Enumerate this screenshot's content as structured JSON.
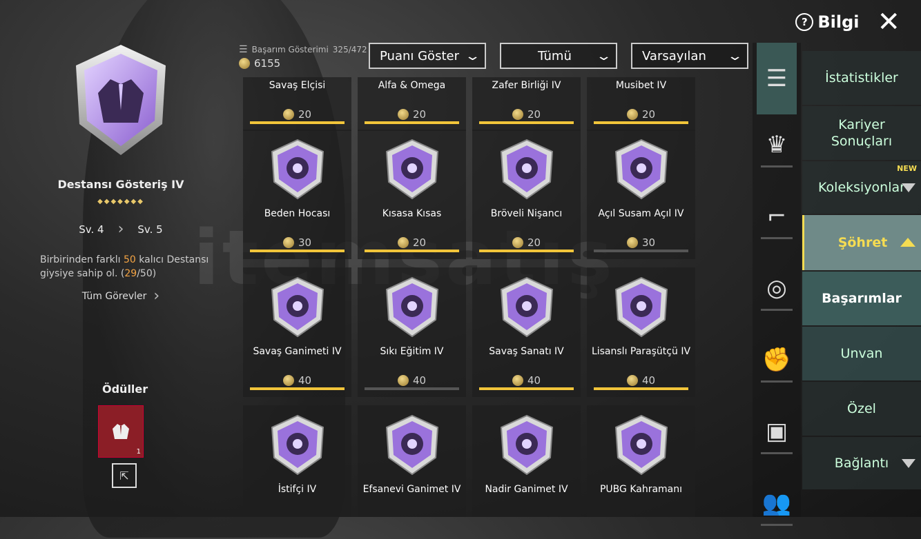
{
  "header": {
    "help_label": "Bilgi",
    "close_symbol": "✕"
  },
  "selected": {
    "name": "Destansı Gösteriş IV",
    "diamonds": "◆◆◆◆◆◆◆",
    "level_from": "Sv. 4",
    "level_to": "Sv. 5",
    "desc_a": "Birbirinden farklı ",
    "desc_hl1": "50",
    "desc_b": " kalıcı Destansı giysiye sahip ol. (",
    "desc_hl2": "29",
    "desc_c": "/50)",
    "all_tasks": "Tüm Görevler"
  },
  "rewards": {
    "title": "Ödüller",
    "count": "1"
  },
  "stats": {
    "label": "Başarım Gösterimi",
    "value": "325/472",
    "points": "6155"
  },
  "filters": [
    {
      "label": "Puanı Göster"
    },
    {
      "label": "Tümü"
    },
    {
      "label": "Varsayılan"
    }
  ],
  "achievements": [
    {
      "title": "Savaş Elçisi",
      "points": "20",
      "progress": 1.0
    },
    {
      "title": "Alfa & Omega",
      "points": "20",
      "progress": 1.0
    },
    {
      "title": "Zafer Birliği IV",
      "points": "20",
      "progress": 1.0
    },
    {
      "title": "Musibet IV",
      "points": "20",
      "progress": 1.0
    },
    {
      "title": "Beden Hocası",
      "points": "30",
      "progress": 1.0
    },
    {
      "title": "Kısasa Kısas",
      "points": "20",
      "progress": 1.0
    },
    {
      "title": "Bröveli Nişancı",
      "points": "20",
      "progress": 1.0
    },
    {
      "title": "Açıl Susam Açıl IV",
      "points": "30",
      "progress": 0.0
    },
    {
      "title": "Savaş Ganimeti IV",
      "points": "40",
      "progress": 1.0
    },
    {
      "title": "Sıkı Eğitim IV",
      "points": "40",
      "progress": 0.0
    },
    {
      "title": "Savaş Sanatı IV",
      "points": "40",
      "progress": 1.0
    },
    {
      "title": "Lisanslı Paraşütçü IV",
      "points": "40",
      "progress": 1.0
    },
    {
      "title": "İstifçi IV",
      "points": "",
      "progress": 0.0
    },
    {
      "title": "Efsanevi Ganimet IV",
      "points": "",
      "progress": 0.0
    },
    {
      "title": "Nadir Ganimet IV",
      "points": "",
      "progress": 0.0
    },
    {
      "title": "PUBG Kahramanı",
      "points": "",
      "progress": 0.0
    }
  ],
  "side_icons": [
    "list-icon",
    "crown-icon",
    "pistol-icon",
    "medal-icon",
    "muscle-icon",
    "crate-icon",
    "friends-icon"
  ],
  "menu": {
    "statistics": "İstatistikler",
    "career_line1": "Kariyer",
    "career_line2": "Sonuçları",
    "collections": "Koleksiyonlar",
    "new_badge": "NEW",
    "fame": "Şöhret",
    "achievements": "Başarımlar",
    "title": "Unvan",
    "special": "Özel",
    "connection": "Bağlantı"
  },
  "watermark": "itemsatış",
  "colors": {
    "accent": "#f5dc52",
    "purple": "#8f63d2",
    "progress": "#f2c53a"
  }
}
